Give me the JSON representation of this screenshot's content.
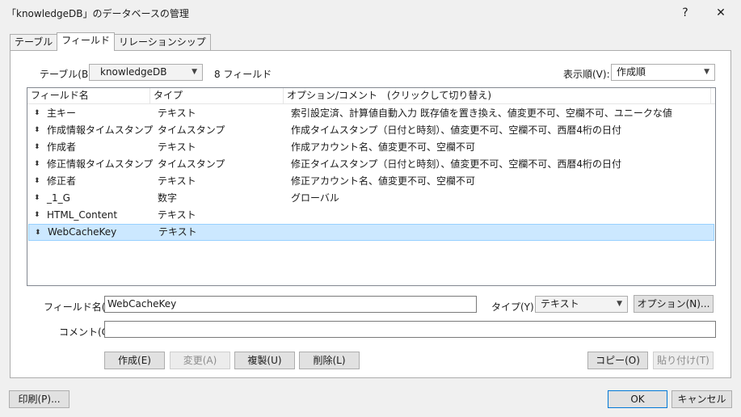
{
  "window": {
    "title": "「knowledgeDB」のデータベースの管理",
    "help_glyph": "?",
    "close_glyph": "✕"
  },
  "tabs": [
    {
      "label": "テーブル"
    },
    {
      "label": "フィールド"
    },
    {
      "label": "リレーションシップ"
    }
  ],
  "table_selector": {
    "label": "テーブル(B):",
    "value": "knowledgeDB",
    "field_count": "8 フィールド"
  },
  "sort": {
    "label": "表示順(V):",
    "value": "作成順"
  },
  "columns": [
    "フィールド名",
    "タイプ",
    "オプション/コメント　(クリックして切り替え)"
  ],
  "rows": [
    {
      "name": "主キー",
      "type": "テキスト",
      "options": "索引設定済、計算値自動入力  既存値を置き換え、値変更不可、空欄不可、ユニークな値"
    },
    {
      "name": "作成情報タイムスタンプ",
      "type": "タイムスタンプ",
      "options": "作成タイムスタンプ（日付と時刻）、値変更不可、空欄不可、西暦4桁の日付"
    },
    {
      "name": "作成者",
      "type": "テキスト",
      "options": "作成アカウント名、値変更不可、空欄不可"
    },
    {
      "name": "修正情報タイムスタンプ",
      "type": "タイムスタンプ",
      "options": "修正タイムスタンプ（日付と時刻）、値変更不可、空欄不可、西暦4桁の日付"
    },
    {
      "name": "修正者",
      "type": "テキスト",
      "options": "修正アカウント名、値変更不可、空欄不可"
    },
    {
      "name": "_1_G",
      "type": "数字",
      "options": "グローバル"
    },
    {
      "name": "HTML_Content",
      "type": "テキスト",
      "options": ""
    },
    {
      "name": "WebCacheKey",
      "type": "テキスト",
      "options": ""
    }
  ],
  "selected_row": "WebCacheKey",
  "field_form": {
    "name_label": "フィールド名(F):",
    "name_value": "WebCacheKey",
    "type_label": "タイプ(Y):",
    "type_value": "テキスト",
    "options_button": "オプション(N)...",
    "comment_label": "コメント(C):",
    "comment_value": ""
  },
  "actions": {
    "create": "作成(E)",
    "change": "変更(A)",
    "duplicate": "複製(U)",
    "delete": "削除(L)",
    "copy": "コピー(O)",
    "paste": "貼り付け(T)"
  },
  "footer": {
    "print": "印刷(P)...",
    "ok": "OK",
    "cancel": "キャンセル"
  },
  "icons": {
    "help": "help-icon",
    "close": "close-icon",
    "row_handle": "move-handle-icon",
    "dropdown": "chevron-down-icon"
  },
  "colors": {
    "selection_bg": "#cce8ff",
    "selection_border": "#99d1ff",
    "primary_border": "#0078d7"
  }
}
